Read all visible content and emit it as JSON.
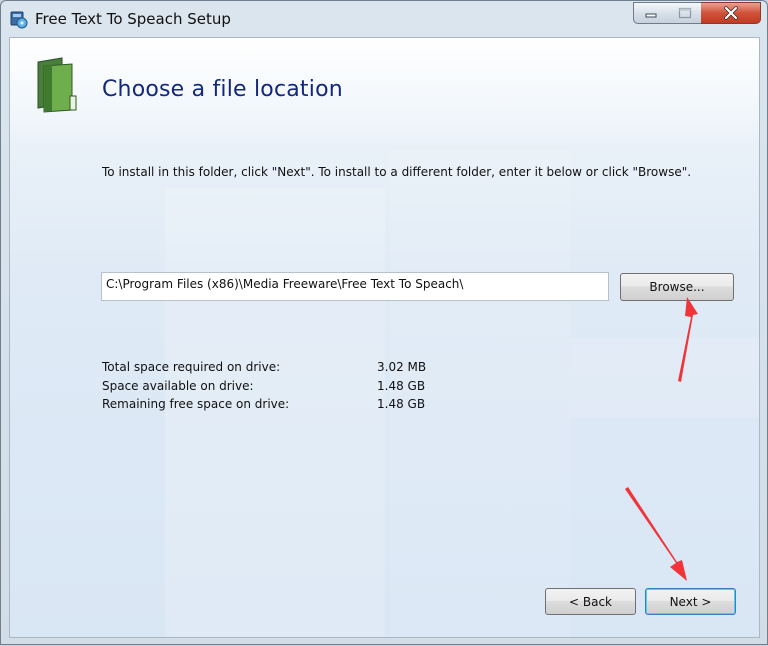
{
  "window": {
    "title": "Free Text To Speach Setup",
    "icons": {
      "app": "installer-app-icon",
      "minimize": "minimize-icon",
      "maximize": "maximize-icon",
      "close": "close-icon"
    }
  },
  "page": {
    "title": "Choose a file location",
    "icon": "green-folder-icon",
    "instructions": "To install in this folder, click \"Next\". To install to a different folder, enter it below or click \"Browse\"."
  },
  "path": {
    "value": "C:\\Program Files (x86)\\Media Freeware\\Free Text To Speach\\"
  },
  "buttons": {
    "browse": "Browse...",
    "back": "< Back",
    "next": "Next >"
  },
  "space_info": [
    {
      "label": "Total space required on drive:",
      "value": "3.02 MB"
    },
    {
      "label": "Space available on drive:",
      "value": "1.48 GB"
    },
    {
      "label": "Remaining free space on drive:",
      "value": "1.48 GB"
    }
  ],
  "colors": {
    "title_blue": "#13287a",
    "annotation_red": "#f0353a",
    "close_red": "#c23b23"
  }
}
